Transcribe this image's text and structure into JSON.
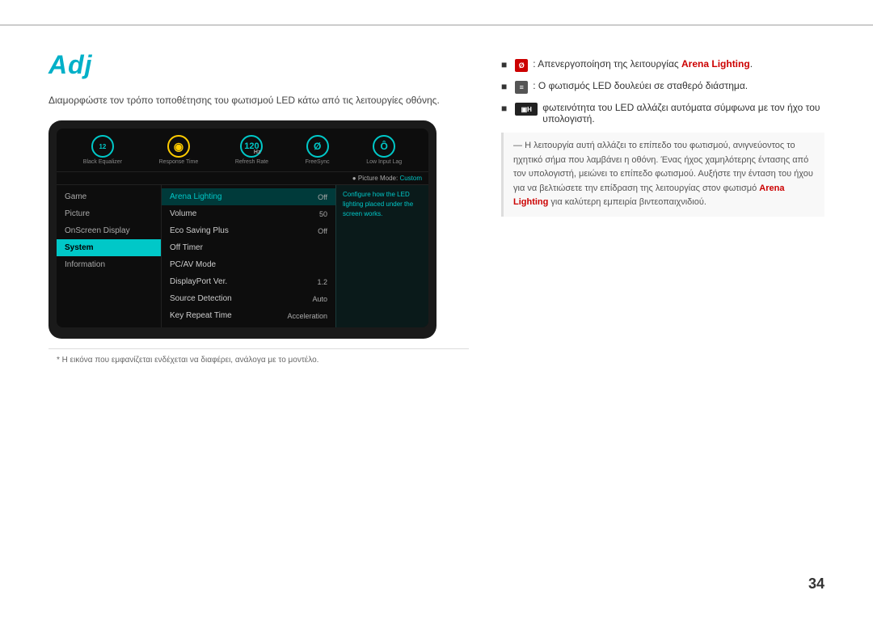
{
  "page": {
    "top_line": true,
    "page_number": "34"
  },
  "left": {
    "title": "Adj",
    "subtitle": "Διαμορφώστε τον τρόπο τοποθέτησης του φωτισμού LED κάτω από τις λειτουργίες οθόνης.",
    "monitor": {
      "icons": [
        {
          "label": "Black Equalizer",
          "value": "12",
          "ring": "teal"
        },
        {
          "label": "Response Time",
          "value": "◉",
          "ring": "yellow"
        },
        {
          "label": "Refresh Rate",
          "value": "120",
          "subtext": "Hz",
          "ring": "teal"
        },
        {
          "label": "FreeSync",
          "value": "0",
          "ring": "teal"
        },
        {
          "label": "Low Input Lag",
          "value": "0̊",
          "ring": "teal"
        }
      ],
      "picture_mode": "Picture Mode: Custom",
      "menu_left": [
        {
          "label": "Game",
          "active": false
        },
        {
          "label": "Picture",
          "active": false
        },
        {
          "label": "OnScreen Display",
          "active": false
        },
        {
          "label": "System",
          "active": true
        },
        {
          "label": "Information",
          "active": false
        }
      ],
      "menu_right": [
        {
          "name": "Arena Lighting",
          "value": "Off",
          "highlighted": true
        },
        {
          "name": "Volume",
          "value": "50",
          "highlighted": false
        },
        {
          "name": "Eco Saving Plus",
          "value": "Off",
          "highlighted": false
        },
        {
          "name": "Off Timer",
          "value": "",
          "highlighted": false
        },
        {
          "name": "PC/AV Mode",
          "value": "",
          "highlighted": false
        },
        {
          "name": "DisplayPort Ver.",
          "value": "1.2",
          "highlighted": false
        },
        {
          "name": "Source Detection",
          "value": "Auto",
          "highlighted": false
        },
        {
          "name": "Key Repeat Time",
          "value": "Acceleration",
          "highlighted": false
        }
      ],
      "config_text": "Configure how the LED lighting placed under the screen works."
    },
    "footnote": "* Η εικόνα που εμφανίζεται ενδέχεται να διαφέρει, ανάλογα με το μοντέλο."
  },
  "right": {
    "bullets": [
      {
        "icon_type": "red",
        "icon_text": "0",
        "text_before": ": Απενεργοποίηση της λειτουργίας ",
        "highlight": "Arena Lighting",
        "text_after": "."
      },
      {
        "icon_type": "gray",
        "icon_text": "≡",
        "text_before": ": Ο φωτισμός LED δουλεύει σε σταθερό διάστημα.",
        "highlight": "",
        "text_after": ""
      },
      {
        "icon_type": "none",
        "text": "H φωτεινότητα του LED αλλάζει αυτόματα σύμφωνα με τον ήχο του υπολογιστή."
      }
    ],
    "subnote": "Η λειτουργία αυτή αλλάζει το επίπεδο του φωτισμού, ανιγνεύοντος το ηχητικό σήμα που λαμβάνει η οθόνη. Ένας ήχος χαμηλότερης έντασης από τον υπολογιστή, μειώνει το επίπεδο φωτισμού. Αυξήστε την ένταση του ήχου για να βελτιώσετε την επίδραση της λειτουργίας στον φωτισμό ",
    "subnote_highlight": "Arena Lighting",
    "subnote_end": " για καλύτερη εμπειρία βιντεοπαιχνιδιού."
  }
}
